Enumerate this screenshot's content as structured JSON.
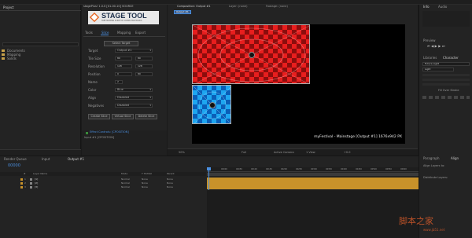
{
  "project_panel": {
    "title": "Project",
    "folders": [
      "Documents",
      "Mapping",
      "Solids"
    ]
  },
  "plugin": {
    "header": "stagePlus! 1.0.0 [01-00-10] SOURCE",
    "logo_text": "STAGE TOOL",
    "logo_sub": "FREE MAPPING SCRIPT BY COMMU MAP BASICS",
    "tabs": [
      "Tools",
      "Slice",
      "Mapping",
      "Export"
    ],
    "select_target_label": "Select Target",
    "rows": [
      {
        "label": "Target",
        "value": "Output #1"
      },
      {
        "label": "Tile Size",
        "value1": "80",
        "value2": "80"
      },
      {
        "label": "Resolution",
        "value1": "128",
        "value2": "128"
      },
      {
        "label": "Position",
        "value1": "0",
        "value2": "80"
      },
      {
        "label": "Name",
        "value": "2"
      },
      {
        "label": "Color",
        "value": "Blue"
      },
      {
        "label": "Align",
        "value": "Disabled"
      },
      {
        "label": "Negatives",
        "value": "Disabled"
      }
    ],
    "buttons": [
      "Create Slice",
      "Virtual Slice",
      "Delete Slice"
    ]
  },
  "effect_controls": {
    "label": "Effect Controls: [CPOSITION]",
    "sub": "Input #1 [CPOSITION]"
  },
  "viewer": {
    "tabs": [
      "Composition: Output #1",
      "Layer: (none)",
      "Footage: (none)"
    ],
    "active_tab": "Output #1",
    "overlay_text": "myFestival - Mainstage [Output #1] 1676x942 PX",
    "zoom": "50%",
    "resolution": "Full",
    "camera": "Active Camera",
    "view": "1 View",
    "timecode": "+0.0"
  },
  "right_panel": {
    "tabs": [
      "Info",
      "Audio"
    ],
    "preview_label": "Preview",
    "library_label": "Libraries",
    "character_label": "Character",
    "font": "Futura Light",
    "style": "Light",
    "paragraph_label": "Paragraph",
    "align_label": "Align",
    "align_layers_to": "Align Layers to:",
    "distribute_label": "Distribute Layers:",
    "stroke_option": "Fill Over Stroke"
  },
  "timeline": {
    "tabs": [
      "Render Queue",
      "Input",
      "Output #1"
    ],
    "timecode": "00000",
    "columns": [
      "#",
      "Layer Name",
      "Mode",
      "T TrkMat",
      "Parent"
    ],
    "layers": [
      {
        "num": "1",
        "name": "[1]",
        "mode": "Normal",
        "trkmat": "None",
        "parent": "None"
      },
      {
        "num": "2",
        "name": "[2]",
        "mode": "Normal",
        "trkmat": "None",
        "parent": "None"
      },
      {
        "num": "3",
        "name": "[3]",
        "mode": "Normal",
        "trkmat": "None",
        "parent": "None"
      }
    ],
    "ruler": [
      "00000",
      "00050",
      "00100",
      "00150",
      "00200",
      "00250",
      "00300",
      "00350",
      "00400",
      "00450",
      "00500",
      "00550",
      "00600",
      "00650"
    ]
  },
  "watermark": {
    "main": "脚本之家",
    "url": "www.jb51.net"
  },
  "colors": {
    "accent_blue": "#4a8fe0",
    "red_tile": "#e81e1e",
    "blue_tile": "#1ea6f0",
    "track_orange": "#c8922a"
  }
}
